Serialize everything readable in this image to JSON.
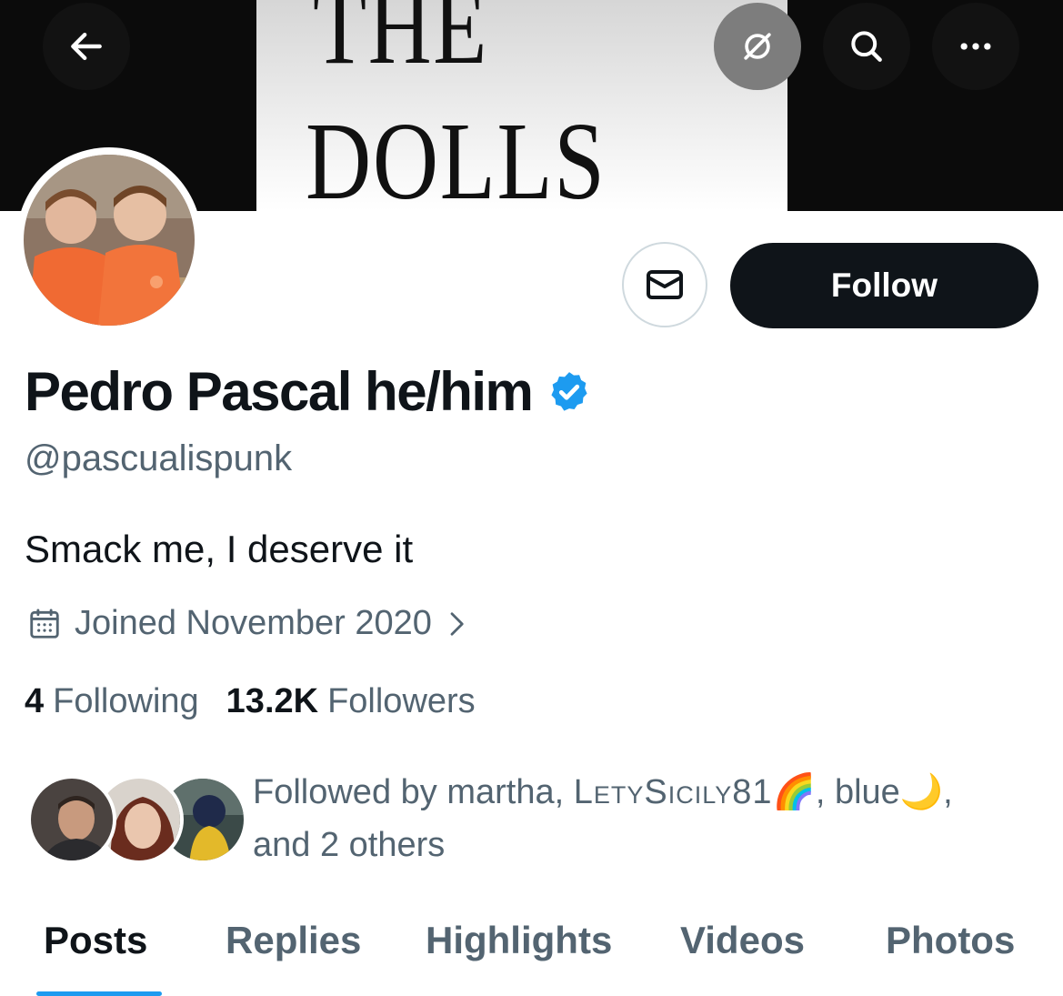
{
  "banner": {
    "line1": "THE",
    "line2": "DOLLS"
  },
  "top_bar": {
    "back_icon": "arrow-left-icon",
    "translate_icon": "slashed-circle-icon",
    "search_icon": "search-icon",
    "more_icon": "more-horizontal-icon"
  },
  "profile": {
    "display_name": "Pedro Pascal he/him",
    "verified_icon": "verified-badge-icon",
    "verified_color": "#1d9bf0",
    "handle": "@pascualispunk",
    "bio": "Smack me, I deserve it",
    "joined": "Joined November 2020"
  },
  "actions": {
    "message_icon": "envelope-icon",
    "follow_label": "Follow"
  },
  "stats": {
    "following_count": "4",
    "following_label": "Following",
    "followers_count": "13.2K",
    "followers_label": "Followers"
  },
  "followed_by": {
    "prefix": "Followed by martha, ",
    "name2": "LetySicily81",
    "emoji2": "🌈",
    "sep": ", blue",
    "emoji3": "🌙",
    "suffix": ",",
    "line2": "and 2 others"
  },
  "tabs": [
    {
      "label": "Posts"
    },
    {
      "label": "Replies"
    },
    {
      "label": "Highlights"
    },
    {
      "label": "Videos"
    },
    {
      "label": "Photos"
    }
  ],
  "colors": {
    "text_primary": "#0f1419",
    "text_secondary": "#536471",
    "accent": "#1d9bf0",
    "follow_bg": "#0f1419"
  }
}
